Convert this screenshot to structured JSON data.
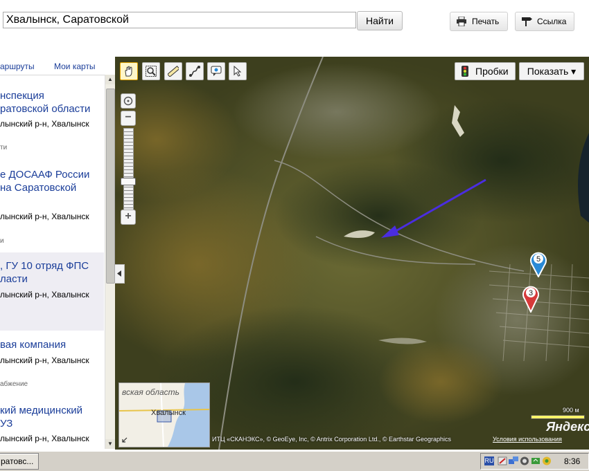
{
  "toolbar": {
    "search_value": "Хвалынск, Саратовской",
    "find_label": "Найти",
    "print_label": "Печать",
    "link_label": "Ссылка"
  },
  "sidebar": {
    "tabs": [
      "аршруты",
      "Мои карты"
    ],
    "results": [
      {
        "title_lines": [
          "нспекция",
          "ратовской области"
        ],
        "address": "лынский р-н, Хвалынск",
        "category": "ти"
      },
      {
        "title_lines": [
          "е ДОСААФ России",
          "на Саратовской"
        ],
        "address": "лынский р-н, Хвалынск",
        "category": "и"
      },
      {
        "title_lines": [
          ", ГУ 10 отряд ФПС",
          "ласти"
        ],
        "address": "лынский р-н, Хвалынск",
        "category": ""
      },
      {
        "title_lines": [
          "вая компания"
        ],
        "address": "лынский р-н, Хвалынск",
        "category": "абжение"
      },
      {
        "title_lines": [
          "кий медицинский",
          "УЗ"
        ],
        "address": "лынский р-н, Хвалынск",
        "category": ""
      }
    ]
  },
  "map": {
    "traffic_label": "Пробки",
    "show_label": "Показать ▾",
    "markers": [
      "5",
      "3"
    ],
    "minimap": {
      "region_label": "вская область",
      "city_label": "Хвалынск"
    },
    "scale_label": "900 м",
    "copyright": "ИТЦ «СКАНЭКС», © GeoEye, Inc, © Antrix Corporation Ltd., © Earthstar Geographics",
    "terms_label": "Условия использования",
    "logo": "Яндекс"
  },
  "taskbar": {
    "task_label": "ратовс...",
    "lang": "RU",
    "clock": "8:36"
  },
  "colors": {
    "link": "#1a3d99",
    "arrow": "#4a2de0",
    "marker_blue": "#2a8ad6",
    "marker_red": "#d63a3a",
    "scale": "#fff36b"
  }
}
